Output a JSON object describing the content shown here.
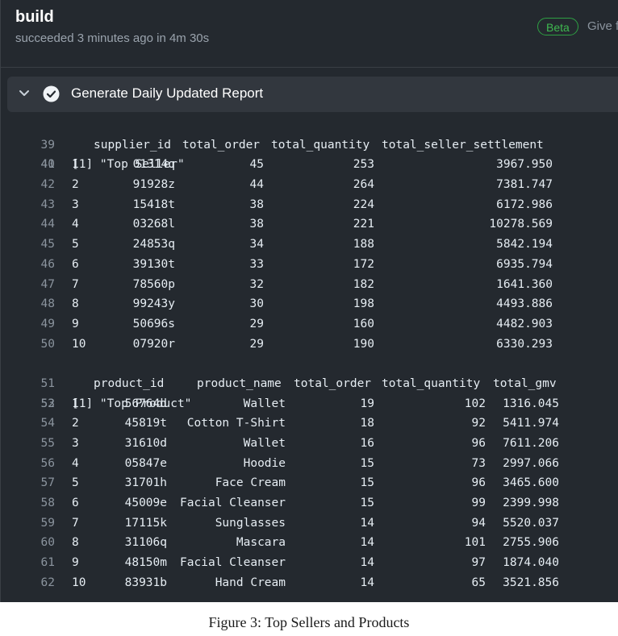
{
  "header": {
    "title": "build",
    "status": "succeeded 3 minutes ago in 4m 30s",
    "beta_badge": "Beta",
    "give_feedback": "Give f"
  },
  "step": {
    "title": "Generate Daily Updated Report",
    "icons": {
      "toggle": "chevron-down-icon",
      "status": "check-circle-icon"
    }
  },
  "log": {
    "seller_title": {
      "line": "39",
      "text": "[1] \"Top Seller\""
    },
    "seller_header": {
      "line": "40",
      "columns": [
        "supplier_id",
        "total_order",
        "total_quantity",
        "total_seller_settlement"
      ]
    },
    "seller_rows": [
      {
        "line": "41",
        "idx": "1",
        "supplier_id": "01314q",
        "total_order": "45",
        "total_quantity": "253",
        "settlement": "3967.950"
      },
      {
        "line": "42",
        "idx": "2",
        "supplier_id": "91928z",
        "total_order": "44",
        "total_quantity": "264",
        "settlement": "7381.747"
      },
      {
        "line": "43",
        "idx": "3",
        "supplier_id": "15418t",
        "total_order": "38",
        "total_quantity": "224",
        "settlement": "6172.986"
      },
      {
        "line": "44",
        "idx": "4",
        "supplier_id": "03268l",
        "total_order": "38",
        "total_quantity": "221",
        "settlement": "10278.569"
      },
      {
        "line": "45",
        "idx": "5",
        "supplier_id": "24853q",
        "total_order": "34",
        "total_quantity": "188",
        "settlement": "5842.194"
      },
      {
        "line": "46",
        "idx": "6",
        "supplier_id": "39130t",
        "total_order": "33",
        "total_quantity": "172",
        "settlement": "6935.794"
      },
      {
        "line": "47",
        "idx": "7",
        "supplier_id": "78560p",
        "total_order": "32",
        "total_quantity": "182",
        "settlement": "1641.360"
      },
      {
        "line": "48",
        "idx": "8",
        "supplier_id": "99243y",
        "total_order": "30",
        "total_quantity": "198",
        "settlement": "4493.886"
      },
      {
        "line": "49",
        "idx": "9",
        "supplier_id": "50696s",
        "total_order": "29",
        "total_quantity": "160",
        "settlement": "4482.903"
      },
      {
        "line": "50",
        "idx": "10",
        "supplier_id": "07920r",
        "total_order": "29",
        "total_quantity": "190",
        "settlement": "6330.293"
      }
    ],
    "product_title": {
      "line": "51",
      "text": "[1] \"Top Product\""
    },
    "product_header": {
      "line": "52",
      "columns": [
        "product_id",
        "product_name",
        "total_order",
        "total_quantity",
        "total_gmv"
      ]
    },
    "product_rows": [
      {
        "line": "53",
        "idx": "1",
        "product_id": "56764d",
        "product_name": "Wallet",
        "total_order": "19",
        "total_quantity": "102",
        "total_gmv": "1316.045"
      },
      {
        "line": "54",
        "idx": "2",
        "product_id": "45819t",
        "product_name": "Cotton T-Shirt",
        "total_order": "18",
        "total_quantity": "92",
        "total_gmv": "5411.974"
      },
      {
        "line": "55",
        "idx": "3",
        "product_id": "31610d",
        "product_name": "Wallet",
        "total_order": "16",
        "total_quantity": "96",
        "total_gmv": "7611.206"
      },
      {
        "line": "56",
        "idx": "4",
        "product_id": "05847e",
        "product_name": "Hoodie",
        "total_order": "15",
        "total_quantity": "73",
        "total_gmv": "2997.066"
      },
      {
        "line": "57",
        "idx": "5",
        "product_id": "31701h",
        "product_name": "Face Cream",
        "total_order": "15",
        "total_quantity": "96",
        "total_gmv": "3465.600"
      },
      {
        "line": "58",
        "idx": "6",
        "product_id": "45009e",
        "product_name": "Facial Cleanser",
        "total_order": "15",
        "total_quantity": "99",
        "total_gmv": "2399.998"
      },
      {
        "line": "59",
        "idx": "7",
        "product_id": "17115k",
        "product_name": "Sunglasses",
        "total_order": "14",
        "total_quantity": "94",
        "total_gmv": "5520.037"
      },
      {
        "line": "60",
        "idx": "8",
        "product_id": "31106q",
        "product_name": "Mascara",
        "total_order": "14",
        "total_quantity": "101",
        "total_gmv": "2755.906"
      },
      {
        "line": "61",
        "idx": "9",
        "product_id": "48150m",
        "product_name": "Facial Cleanser",
        "total_order": "14",
        "total_quantity": "97",
        "total_gmv": "1874.040"
      },
      {
        "line": "62",
        "idx": "10",
        "product_id": "83931b",
        "product_name": "Hand Cream",
        "total_order": "14",
        "total_quantity": "65",
        "total_gmv": "3521.856"
      }
    ]
  },
  "caption": "Figure 3: Top Sellers and Products",
  "colors": {
    "panel_background": "#24292f",
    "step_bar": "#32373e",
    "success_green": "#3fb950",
    "line_number": "#8b949e",
    "log_text": "#e6edf3"
  }
}
